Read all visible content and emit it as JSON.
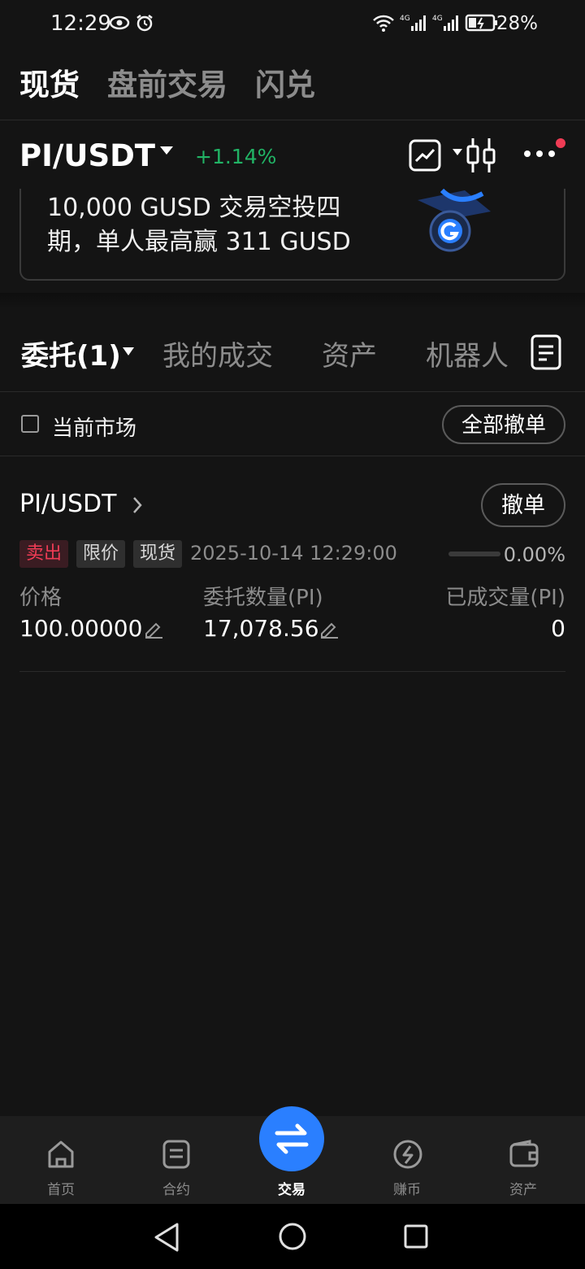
{
  "status_bar": {
    "time": "12:29",
    "battery": "28%"
  },
  "top_tabs": [
    "现货",
    "盘前交易",
    "闪兑"
  ],
  "pair": {
    "name": "PI/USDT",
    "change": "+1.14%"
  },
  "banner": {
    "line1": "10,000 GUSD 交易空投四",
    "line2": "期，单人最高赢 311 GUSD"
  },
  "order_tabs": [
    "委托(1)",
    "我的成交",
    "资产",
    "机器人"
  ],
  "filter": {
    "current_market_label": "当前市场",
    "cancel_all_label": "全部撤单"
  },
  "order": {
    "pair": "PI/USDT",
    "cancel_label": "撤单",
    "side": "卖出",
    "order_type": "限价",
    "market_type": "现货",
    "datetime": "2025-10-14 12:29:00",
    "fill_percent": "0.00%",
    "fill_fraction": 0,
    "price_label": "价格",
    "price": "100.00000",
    "amount_label": "委托数量(PI)",
    "amount": "17,078.56",
    "filled_label": "已成交量(PI)",
    "filled": "0"
  },
  "bottom_nav": [
    "首页",
    "合约",
    "交易",
    "赚币",
    "资产"
  ],
  "colors": {
    "green": "#21b365",
    "red": "#f03c55",
    "accent": "#2a7fff",
    "bg": "#141414"
  }
}
